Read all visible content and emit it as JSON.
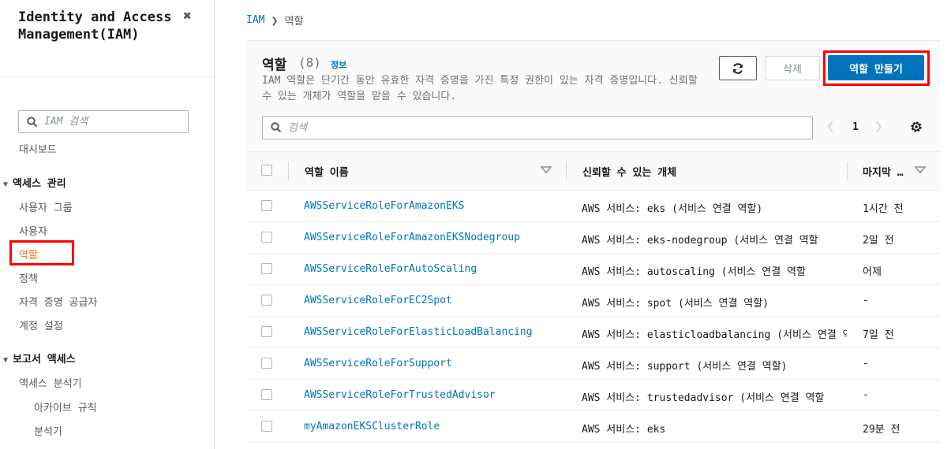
{
  "sidebar": {
    "title": "Identity and Access Management(IAM)",
    "search_placeholder": "IAM 검색",
    "dashboard": "대시보드",
    "access_mgmt": "액세스 관리",
    "user_groups": "사용자 그룹",
    "users": "사용자",
    "roles": "역할",
    "policies": "정책",
    "identity_providers": "자격 증명 공급자",
    "account_settings": "계정 설정",
    "report_access": "보고서 액세스",
    "access_analyzer": "액세스 분석기",
    "archive_rules": "아카이브 규칙",
    "analyzers": "분석기"
  },
  "breadcrumb": {
    "root": "IAM",
    "current": "역할"
  },
  "header": {
    "title": "역할",
    "count": "(8)",
    "info": "정보",
    "description": "IAM 역할은 단기간 동안 유효한 자격 증명을 가진 특정 권한이 있는 자격 증명입니다. 신뢰할 수 있는 개체가 역할을 맡을 수 있습니다."
  },
  "buttons": {
    "delete": "삭제",
    "create": "역할 만들기"
  },
  "search": {
    "placeholder": "검색"
  },
  "pagination": {
    "page": "1"
  },
  "table": {
    "columns": {
      "name": "역할 이름",
      "trusted": "신뢰할 수 있는 개체",
      "last": "마지막 …"
    },
    "rows": [
      {
        "name": "AWSServiceRoleForAmazonEKS",
        "trust_prefix": "AWS 서비스: eks (",
        "trust_link": "서비스 연결 역할",
        "trust_suffix": ")",
        "last": "1시간 전"
      },
      {
        "name": "AWSServiceRoleForAmazonEKSNodegroup",
        "trust_prefix": "AWS 서비스: eks-nodegroup (",
        "trust_link": "서비스 연결 역할",
        "trust_suffix": "",
        "last": "2일 전"
      },
      {
        "name": "AWSServiceRoleForAutoScaling",
        "trust_prefix": "AWS 서비스: autoscaling (",
        "trust_link": "서비스 연결 역할",
        "trust_suffix": "",
        "last": "어제"
      },
      {
        "name": "AWSServiceRoleForEC2Spot",
        "trust_prefix": "AWS 서비스: spot (",
        "trust_link": "서비스 연결 역할",
        "trust_suffix": ")",
        "last": "-"
      },
      {
        "name": "AWSServiceRoleForElasticLoadBalancing",
        "trust_prefix": "AWS 서비스: elasticloadbalancing (",
        "trust_link": "서비스 연결 역할",
        "trust_suffix": "",
        "last": "7일 전"
      },
      {
        "name": "AWSServiceRoleForSupport",
        "trust_prefix": "AWS 서비스: support (",
        "trust_link": "서비스 연결 역할",
        "trust_suffix": ")",
        "last": "-"
      },
      {
        "name": "AWSServiceRoleForTrustedAdvisor",
        "trust_prefix": "AWS 서비스: trustedadvisor (",
        "trust_link": "서비스 연결 역할",
        "trust_suffix": "",
        "last": "-"
      },
      {
        "name": "myAmazonEKSClusterRole",
        "trust_prefix": "AWS 서비스: eks",
        "trust_link": "",
        "trust_suffix": "",
        "last": "29분 전"
      }
    ]
  },
  "colors": {
    "link": "#0073bb",
    "primary_button": "#0073bb",
    "highlight": "#ff0000",
    "active_nav": "#ec7211"
  }
}
